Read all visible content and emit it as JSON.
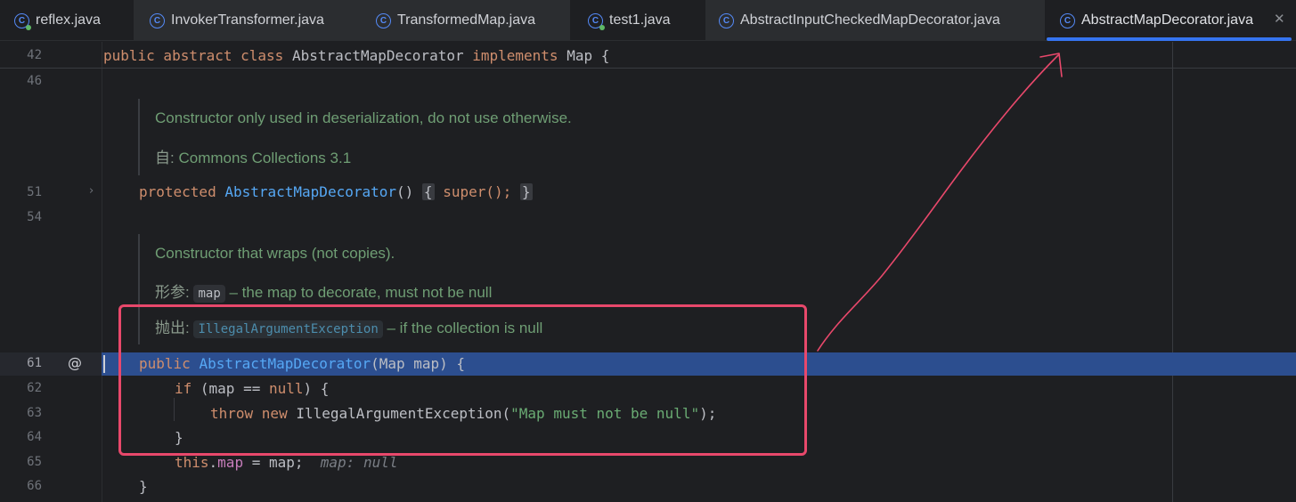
{
  "tabs": [
    {
      "label": "reflex.java",
      "icon": "java-class-run-icon"
    },
    {
      "label": "InvokerTransformer.java",
      "icon": "java-class-icon"
    },
    {
      "label": "TransformedMap.java",
      "icon": "java-class-icon"
    },
    {
      "label": "test1.java",
      "icon": "java-class-run-icon"
    },
    {
      "label": "AbstractInputCheckedMapDecorator.java",
      "icon": "java-class-icon"
    },
    {
      "label": "AbstractMapDecorator.java",
      "icon": "java-class-icon",
      "active": true
    }
  ],
  "tab_icon_glyph": "C",
  "close_glyph": "✕",
  "fold_glyph": "›",
  "at_glyph": "@",
  "sticky": {
    "line": "42",
    "kw1": "public abstract class",
    "name": "AbstractMapDecorator",
    "kw2": "implements",
    "rest": "Map {"
  },
  "line_numbers": {
    "l46": "46",
    "l51": "51",
    "l54": "54",
    "l61": "61",
    "l62": "62",
    "l63": "63",
    "l64": "64",
    "l65": "65",
    "l66": "66"
  },
  "doc1": {
    "text": "Constructor only used in deserialization, do not use otherwise.",
    "since_label": "自:",
    "since_value": "Commons Collections 3.1"
  },
  "line51": {
    "kw": "protected",
    "name": "AbstractMapDecorator",
    "parens": "()",
    "open": "{",
    "body": "super();",
    "close": "}"
  },
  "doc2": {
    "text": "Constructor that wraps (not copies).",
    "param_label": "形参:",
    "param_name": "map",
    "param_desc": "– the map to decorate, must not be null",
    "throws_label": "抛出:",
    "throws_name": "IllegalArgumentException",
    "throws_desc": "– if the collection is null"
  },
  "code": {
    "l61_kw": "public",
    "l61_name": "AbstractMapDecorator",
    "l61_rest": "(Map map) {",
    "l62_kw": "if",
    "l62_a": " (map == ",
    "l62_null": "null",
    "l62_b": ") {",
    "l63_kw": "throw new",
    "l63_a": " IllegalArgumentException(",
    "l63_str": "\"Map must not be null\"",
    "l63_b": ");",
    "l64": "}",
    "l65_kw": "this",
    "l65_dot": ".",
    "l65_fld": "map",
    "l65_rest": " = map;",
    "l65_hint": "map: null",
    "l66": "}"
  },
  "colors": {
    "keyword": "#cf8e6d",
    "function": "#56a8f5",
    "string": "#6aab73",
    "field": "#c77dbb",
    "doc": "#6f9e74",
    "annotation": "#e8486b",
    "selection": "#2c4e8f"
  }
}
